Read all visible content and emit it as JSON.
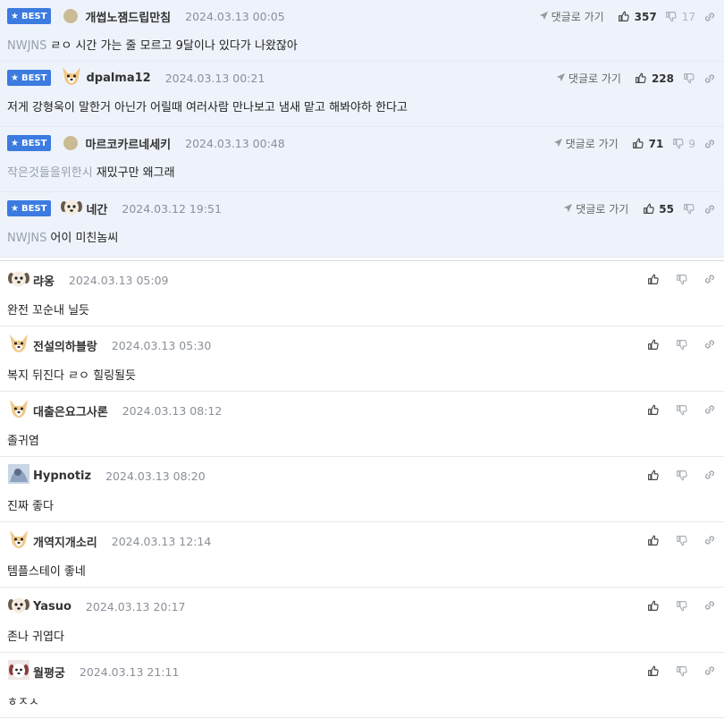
{
  "best_badge": "BEST",
  "reply_link_label": "댓글로 가기",
  "best_comments": [
    {
      "nick": "개썹노잼드립만침",
      "date": "2024.03.13 00:05",
      "ref": "NWJNS",
      "text": "ㄹㅇ 시간 가는 줄 모르고 9달이나 있다가 나왔잖아",
      "up": "357",
      "down": "17",
      "avatar": "dot"
    },
    {
      "nick": "dpalma12",
      "date": "2024.03.13 00:21",
      "ref": "",
      "text": "저게 강형욱이 말한거 아닌가 어릴때 여러사람 만나보고 냄새 맡고 해봐야하 한다고",
      "up": "228",
      "down": "",
      "avatar": "fox"
    },
    {
      "nick": "마르코카르네세키",
      "date": "2024.03.13 00:48",
      "ref": "작은것들을위한시",
      "text": "재밌구만 왜그래",
      "up": "71",
      "down": "9",
      "avatar": "dot"
    },
    {
      "nick": "네간",
      "date": "2024.03.12 19:51",
      "ref": "NWJNS",
      "text": "어이 미친놈씨",
      "up": "55",
      "down": "",
      "avatar": "puppy"
    }
  ],
  "comments": [
    {
      "nick": "랴옹",
      "date": "2024.03.13 05:09",
      "text": "완전 꼬순내 닐듯",
      "avatar": "puppy"
    },
    {
      "nick": "전설의하블랑",
      "date": "2024.03.13 05:30",
      "text": "복지 뒤진다 ㄹㅇ 힐링될듯",
      "avatar": "fox"
    },
    {
      "nick": "대출은요그사론",
      "date": "2024.03.13 08:12",
      "text": "졸귀염",
      "avatar": "fox"
    },
    {
      "nick": "Hypnotiz",
      "date": "2024.03.13 08:20",
      "text": "진짜 좋다",
      "avatar": "photo"
    },
    {
      "nick": "개역지개소리",
      "date": "2024.03.13 12:14",
      "text": "템플스테이 좋네",
      "avatar": "fox"
    },
    {
      "nick": "Yasuo",
      "date": "2024.03.13 20:17",
      "text": "존나 귀엽다",
      "avatar": "puppy"
    },
    {
      "nick": "월평궁",
      "date": "2024.03.13 21:11",
      "text": "ㅎㅈㅅ",
      "avatar": "photo2"
    }
  ]
}
